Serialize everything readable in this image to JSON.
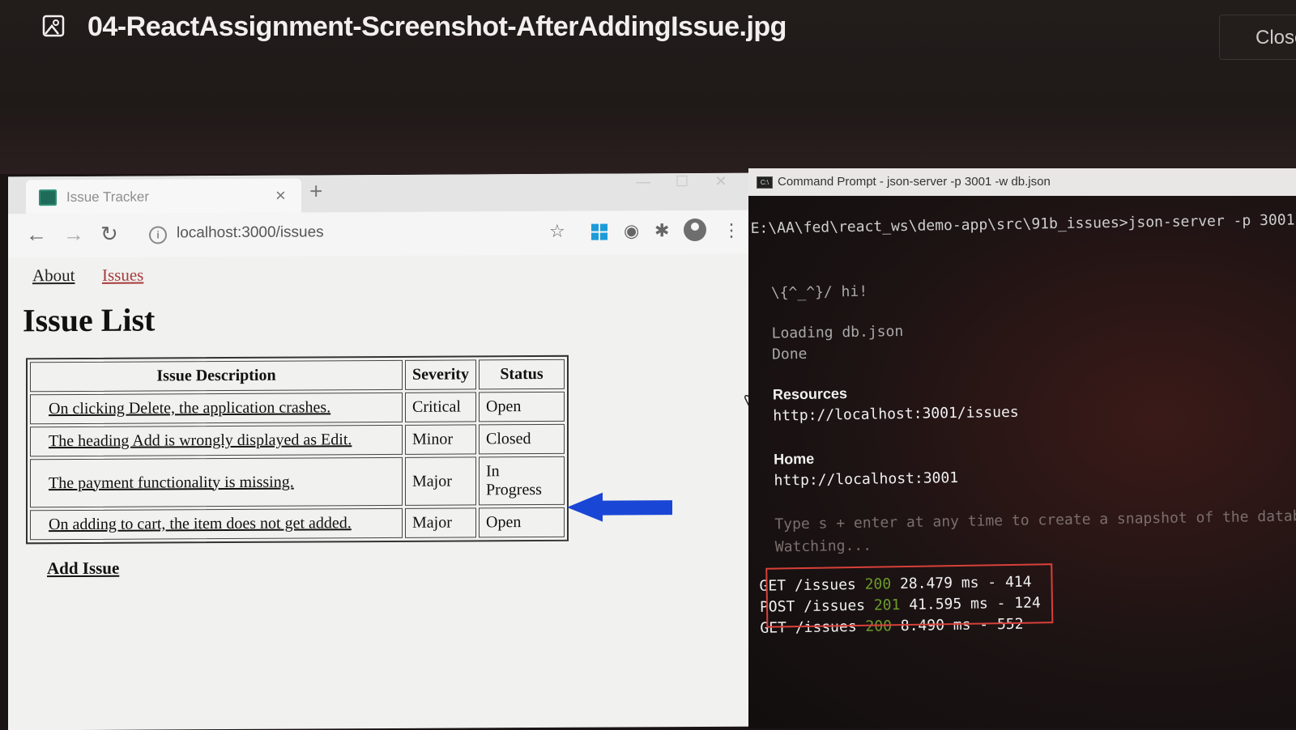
{
  "viewer": {
    "file_name": "04-ReactAssignment-Screenshot-AfterAddingIssue.jpg",
    "close_label": "Close"
  },
  "browser": {
    "tab_title": "Issue Tracker",
    "tab_close": "×",
    "new_tab": "+",
    "url": "localhost:3000/issues",
    "window_controls": [
      "—",
      "☐",
      "✕"
    ]
  },
  "page": {
    "nav": {
      "about": "About",
      "issues": "Issues"
    },
    "title": "Issue List",
    "table": {
      "headers": {
        "description": "Issue Description",
        "severity": "Severity",
        "status": "Status"
      },
      "rows": [
        {
          "description": "On clicking Delete, the application crashes.",
          "severity": "Critical",
          "status": "Open"
        },
        {
          "description": "The heading Add is wrongly displayed as Edit.",
          "severity": "Minor",
          "status": "Closed"
        },
        {
          "description": "The payment functionality is missing.",
          "severity": "Major",
          "status": "In Progress"
        },
        {
          "description": "On adding to cart, the item does not get added.",
          "severity": "Major",
          "status": "Open"
        }
      ]
    },
    "add_issue": "Add Issue",
    "arrow_color": "#1a46d6"
  },
  "cmd": {
    "title": "Command Prompt - json-server -p 3001 -w db.json",
    "icon_text": "C:\\",
    "prompt_line": "E:\\AA\\fed\\react_ws\\demo-app\\src\\91b_issues>json-server -p 3001",
    "hi": "\\{^_^}/ hi!",
    "loading": "Loading db.json",
    "done": "Done",
    "resources_label": "Resources",
    "resources_url": "http://localhost:3001/issues",
    "home_label": "Home",
    "home_url": "http://localhost:3001",
    "snapshot_hint": "Type s + enter at any time to create a snapshot of the databa",
    "watching": "Watching...",
    "log": [
      {
        "method": "GET",
        "path": "/issues",
        "code": "200",
        "rest": "28.479 ms - 414"
      },
      {
        "method": "POST",
        "path": "/issues",
        "code": "201",
        "rest": "41.595 ms - 124"
      },
      {
        "method": "GET",
        "path": "/issues",
        "code": "200",
        "rest": "8.490 ms - 552"
      }
    ],
    "highlight_color": "#d8403a"
  }
}
